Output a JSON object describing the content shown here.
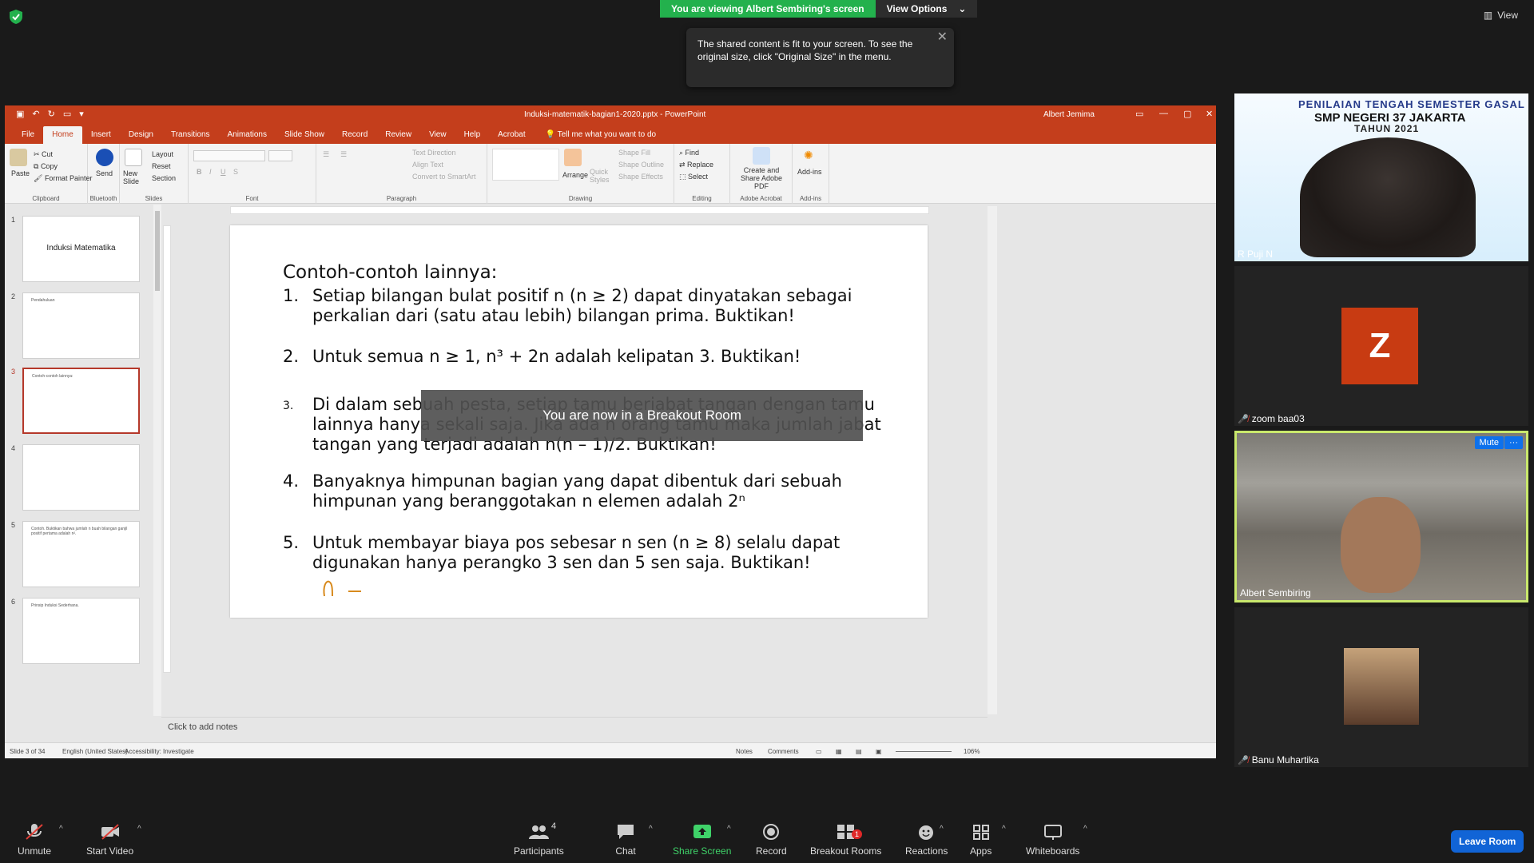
{
  "zoom": {
    "share_banner": "You are viewing Albert Sembiring's screen",
    "view_options": "View Options",
    "view_button": "View",
    "tooltip": "The shared content is fit to your screen. To see the original size, click \"Original Size\" in the menu.",
    "breakout_overlay": "You are now in a Breakout Room"
  },
  "ppt": {
    "title": "Induksi-matematik-bagian1-2020.pptx  -  PowerPoint",
    "user": "Albert Jemima",
    "tabs": [
      "File",
      "Home",
      "Insert",
      "Design",
      "Transitions",
      "Animations",
      "Slide Show",
      "Record",
      "Review",
      "View",
      "Help",
      "Acrobat"
    ],
    "tellme": "Tell me what you want to do",
    "ribbon": {
      "paste": "Paste",
      "cut": "Cut",
      "copy": "Copy",
      "format_painter": "Format Painter",
      "clipboard": "Clipboard",
      "send": "Send",
      "bluetooth": "Bluetooth",
      "new_slide": "New Slide",
      "layout": "Layout",
      "reset": "Reset",
      "section": "Section",
      "slides": "Slides",
      "font": "Font",
      "paragraph": "Paragraph",
      "text_direction": "Text Direction",
      "align_text": "Align Text",
      "convert_smartart": "Convert to SmartArt",
      "arrange": "Arrange",
      "quick_styles": "Quick Styles",
      "shape_fill": "Shape Fill",
      "shape_outline": "Shape Outline",
      "shape_effects": "Shape Effects",
      "drawing": "Drawing",
      "find": "Find",
      "replace": "Replace",
      "select": "Select",
      "editing": "Editing",
      "create_share_pdf": "Create and Share Adobe PDF",
      "adobe_acrobat": "Adobe Acrobat",
      "addins": "Add-ins",
      "addins_group": "Add-ins"
    },
    "thumbnails": [
      {
        "num": "1",
        "title": "Induksi Matematika"
      },
      {
        "num": "2",
        "title": "Pendahuluan"
      },
      {
        "num": "3",
        "title": "Contoh-contoh lainnya:"
      },
      {
        "num": "4",
        "title": ""
      },
      {
        "num": "5",
        "title": "Contoh. Buktikan bahwa jumlah n buah bilangan ganjil positif pertama adalah n²."
      },
      {
        "num": "6",
        "title": "Prinsip Induksi Sederhana."
      }
    ],
    "slide": {
      "title": "Contoh-contoh lainnya:",
      "items": [
        {
          "num": "1.",
          "text": "Setiap bilangan bulat positif n (n ≥ 2) dapat dinyatakan sebagai perkalian dari (satu atau lebih) bilangan prima.  Buktikan!"
        },
        {
          "num": "2.",
          "text": "Untuk semua n ≥ 1, n³ + 2n adalah kelipatan 3. Buktikan!"
        },
        {
          "num": "3.",
          "text": " Di dalam sebuah pesta, setiap tamu berjabat tangan dengan tamu lainnya hanya sekali saja. Jika ada n orang tamu maka jumlah jabat tangan yang terjadi adalah n(n – 1)/2. Buktikan!"
        },
        {
          "num": "4.",
          "text": "Banyaknya himpunan bagian yang dapat dibentuk dari sebuah himpunan yang beranggotakan n elemen adalah 2ⁿ"
        },
        {
          "num": "5.",
          "text": "Untuk membayar biaya pos sebesar n sen (n ≥ 8) selalu dapat digunakan hanya perangko 3 sen dan 5 sen saja. Buktikan!"
        }
      ]
    },
    "notes_placeholder": "Click to add notes",
    "status": {
      "slide": "Slide 3 of 34",
      "language": "English (United States)",
      "accessibility": "Accessibility: Investigate",
      "notes": "Notes",
      "comments": "Comments",
      "zoom": "106%"
    }
  },
  "participants": [
    {
      "name": "R Puji N",
      "banner1": "PENILAIAN TENGAH SEMESTER GASAL",
      "banner2": "SMP NEGERI 37 JAKARTA",
      "banner3": "TAHUN 2021"
    },
    {
      "name": "zoom baa03",
      "initial": "Z",
      "muted": true
    },
    {
      "name": "Albert Sembiring",
      "mute_btn": "Mute",
      "more": "···"
    },
    {
      "name": "Banu Muhartika",
      "muted": true
    }
  ],
  "toolbar": {
    "unmute": "Unmute",
    "start_video": "Start Video",
    "participants": "Participants",
    "participants_count": "4",
    "chat": "Chat",
    "share_screen": "Share Screen",
    "record": "Record",
    "breakout_rooms": "Breakout Rooms",
    "breakout_badge": "1",
    "reactions": "Reactions",
    "apps": "Apps",
    "whiteboards": "Whiteboards",
    "leave_room": "Leave Room"
  },
  "colors": {
    "ppt_accent": "#c43e1c",
    "zoom_green": "#23b14d",
    "zoom_blue": "#0e71eb",
    "active_speaker": "#c9e86c",
    "ink": "#d88a1d"
  }
}
